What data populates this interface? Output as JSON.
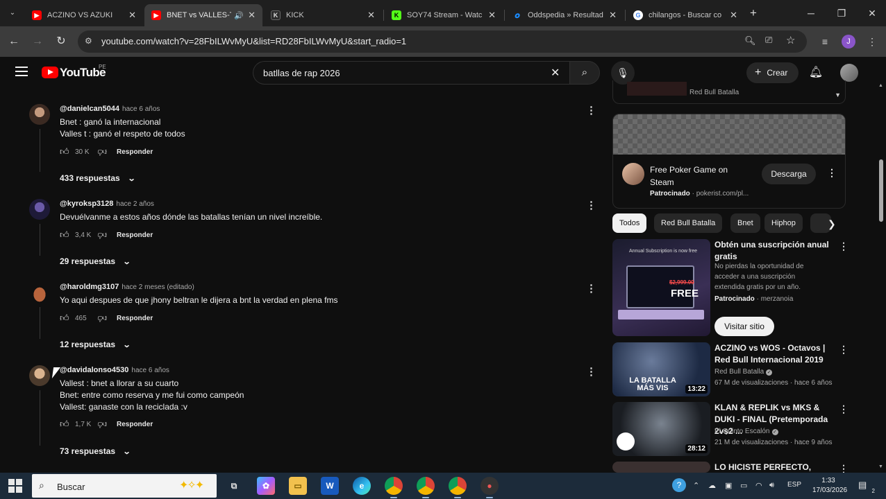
{
  "browser": {
    "tabs": [
      {
        "title": "ACZINO VS AZUKI",
        "icon": "youtube-icon",
        "color": "#ff0000"
      },
      {
        "title": "BNET vs VALLES-T",
        "icon": "youtube-icon",
        "color": "#ff0000",
        "active": true
      },
      {
        "title": "KICK",
        "icon": "kick-icon",
        "color": "#53fc18"
      },
      {
        "title": "SOY74 Stream - Watc",
        "icon": "kick-icon",
        "color": "#53fc18"
      },
      {
        "title": "Oddspedia » Resultad",
        "icon": "oddspedia-icon",
        "color": "#1a8cff"
      },
      {
        "title": "chilangos - Buscar co",
        "icon": "google-icon",
        "color": "#4285f4"
      }
    ],
    "url": "youtube.com/watch?v=28FbILWvMyU&list=RD28FbILWvMyU&start_radio=1",
    "profile_initial": "J"
  },
  "youtube": {
    "logo": "YouTube",
    "country": "PE",
    "search_query": "batllas de rap 2026",
    "create_label": "Crear"
  },
  "comments": [
    {
      "user": "@danielcan5044",
      "time": "hace 6 años",
      "lines": [
        "Bnet : ganó la internacional",
        "Valles t : ganó el respeto de todos"
      ],
      "likes": "30 K",
      "reply_label": "Responder",
      "replies": "433 respuestas"
    },
    {
      "user": "@kyroksp3128",
      "time": "hace 2 años",
      "lines": [
        "Devuélvanme a estos años dónde las batallas tenían un nivel increíble."
      ],
      "likes": "3,4 K",
      "reply_label": "Responder",
      "replies": "29 respuestas"
    },
    {
      "user": "@haroldmg3107",
      "time": "hace 2 meses (editado)",
      "lines": [
        "Yo aqui despues de que jhony beltran le dijera a bnt la verdad en plena fms"
      ],
      "likes": "465",
      "reply_label": "Responder",
      "replies": "12 respuestas"
    },
    {
      "user": "@davidalonso4530",
      "time": "hace 6 años",
      "lines": [
        "Vallest : bnet a llorar a su cuarto",
        "Bnet: entre como reserva y me fui como campeón",
        "Vallest: ganaste con la reciclada :v"
      ],
      "likes": "1,7 K",
      "reply_label": "Responder",
      "replies": "73 respuestas"
    }
  ],
  "sidebar": {
    "mix_channel": "Red Bull Batalla",
    "ad": {
      "title": "Free Poker Game on Steam",
      "sponsored": "Patrocinado",
      "domain": "pokerist.com/pl...",
      "button": "Descarga"
    },
    "chips": [
      "Todos",
      "Red Bull Batalla",
      "Bnet",
      "Hiphop"
    ],
    "recommendations": [
      {
        "title": "Obtén una suscripción anual gratis",
        "description": "No pierdas la oportunidad de acceder a una suscripción extendida gratis por un año.",
        "sponsored": "Patrocinado",
        "advertiser": "merzanoia",
        "button": "Visitar sitio",
        "thumb_badge": "FREE",
        "thumb_price": "$2,999.00",
        "thumb_caption": "Annual Subscription is now free"
      },
      {
        "title": "ACZINO vs WOS - Octavos | Red Bull Internacional 2019",
        "channel": "Red Bull Batalla",
        "stats": "67 M de visualizaciones · hace 6 años",
        "duration": "13:22",
        "thumb_text": "LA BATALLA MÁS VIS"
      },
      {
        "title": "KLAN & REPLIK vs MKS & DUKI - FINAL (Pretemporada 2vs2 ...",
        "channel": "El Quinto Escalón",
        "stats": "21 M de visualizaciones · hace 9 años",
        "duration": "28:12"
      },
      {
        "title": "LO HICISTE PERFECTO, PERO"
      }
    ]
  },
  "taskbar": {
    "search_placeholder": "Buscar",
    "language": "ESP",
    "time": "1:33",
    "date": "17/03/2026",
    "notifications": "2"
  }
}
